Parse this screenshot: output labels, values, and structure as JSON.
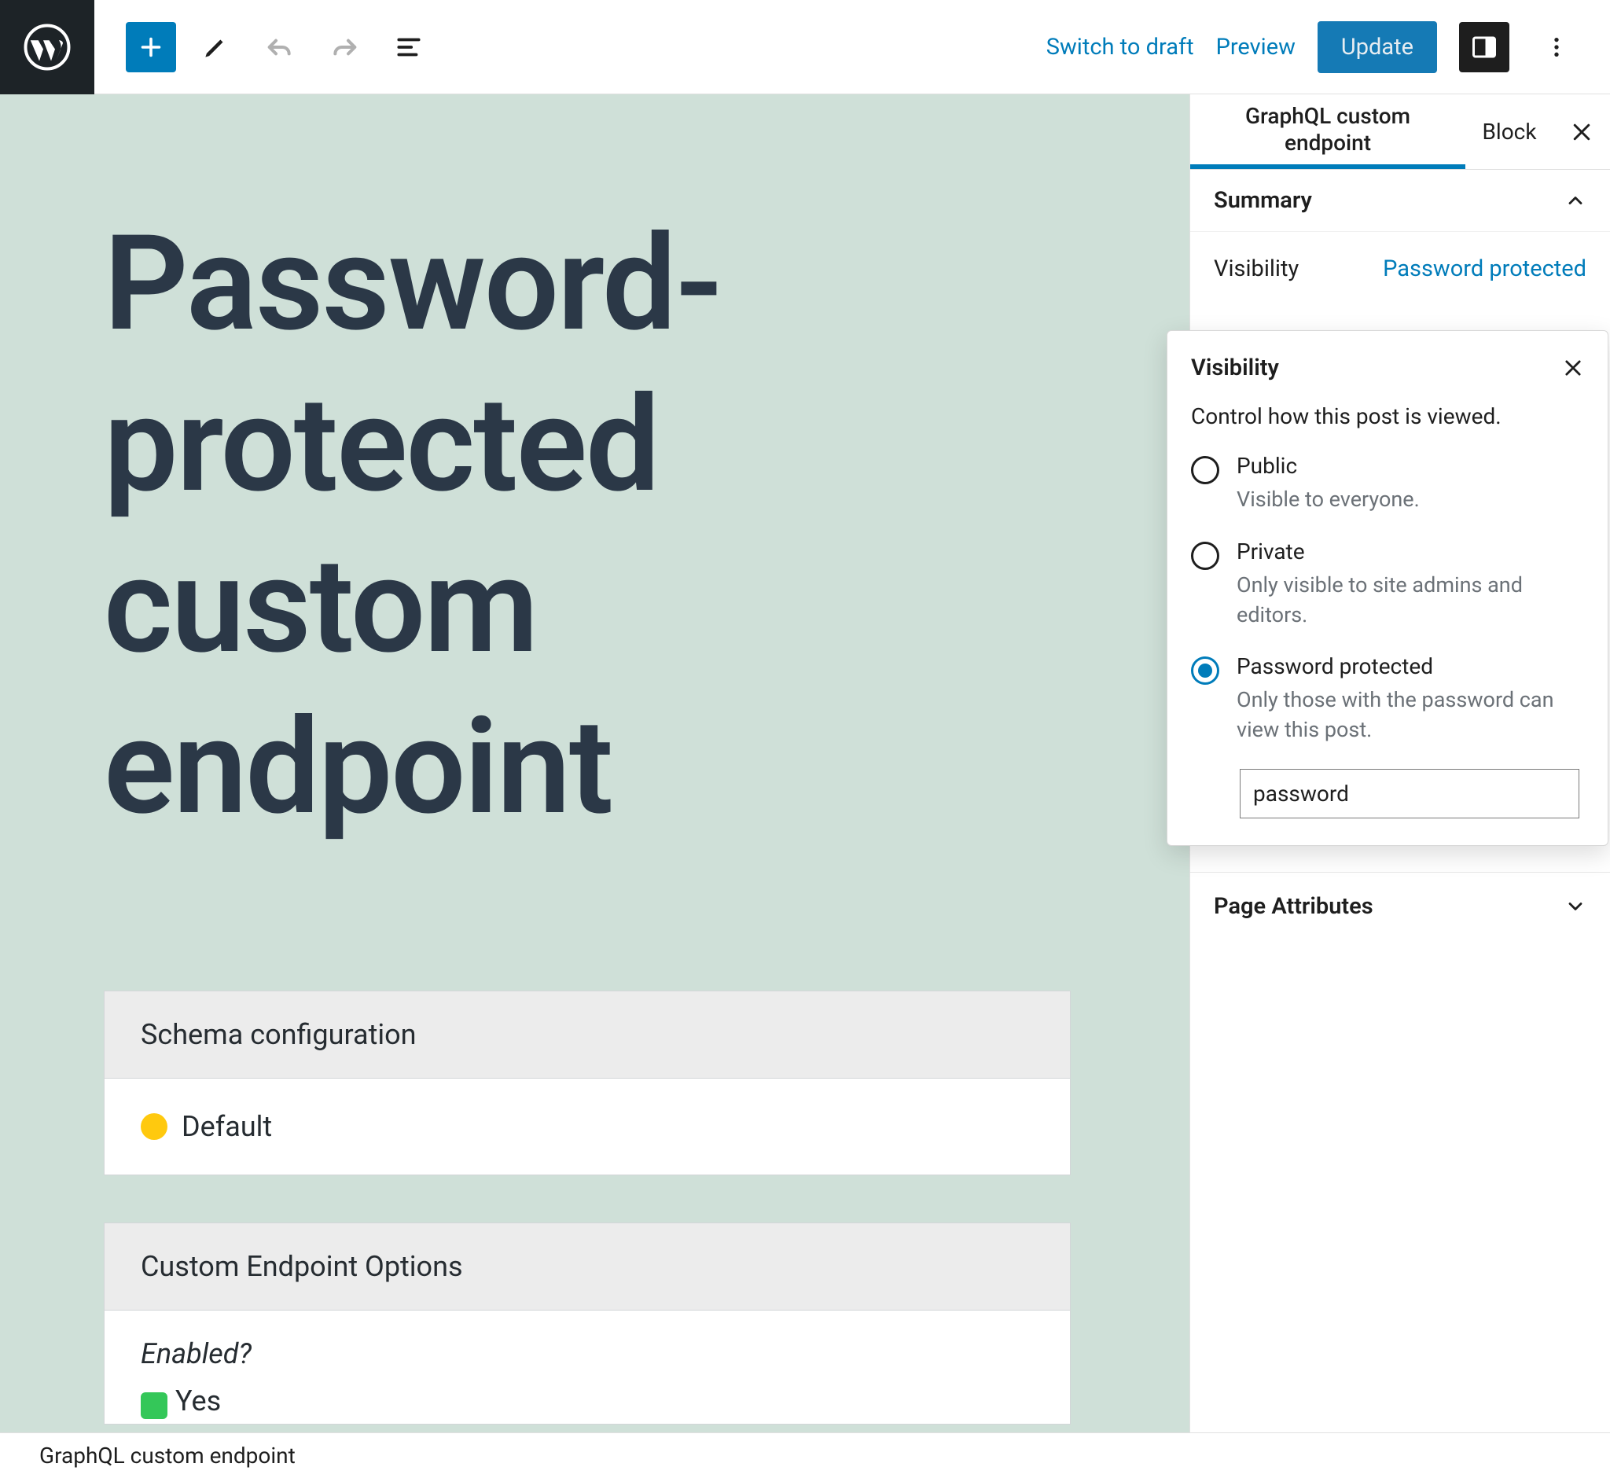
{
  "topbar": {
    "switch_to_draft": "Switch to draft",
    "preview": "Preview",
    "update": "Update"
  },
  "canvas": {
    "title": "Password-protected custom endpoint",
    "panels": [
      {
        "head": "Schema configuration",
        "body_icon": "yellow-dot",
        "body_text": "Default"
      },
      {
        "head": "Custom Endpoint Options",
        "enabled_label": "Enabled?",
        "enabled_icon": "green-check",
        "enabled_value": "Yes"
      }
    ]
  },
  "sidebar": {
    "tabs": {
      "main": "GraphQL custom endpoint",
      "block": "Block"
    },
    "summary": {
      "title": "Summary",
      "rows": [
        {
          "label": "Visibility",
          "value": "Password protected"
        }
      ]
    },
    "page_attributes": "Page Attributes"
  },
  "popover": {
    "title": "Visibility",
    "desc": "Control how this post is viewed.",
    "options": [
      {
        "label": "Public",
        "desc": "Visible to everyone.",
        "selected": false
      },
      {
        "label": "Private",
        "desc": "Only visible to site admins and editors.",
        "selected": false
      },
      {
        "label": "Password protected",
        "desc": "Only those with the password can view this post.",
        "selected": true
      }
    ],
    "password_value": "password"
  },
  "footer": {
    "breadcrumb": "GraphQL custom endpoint"
  }
}
